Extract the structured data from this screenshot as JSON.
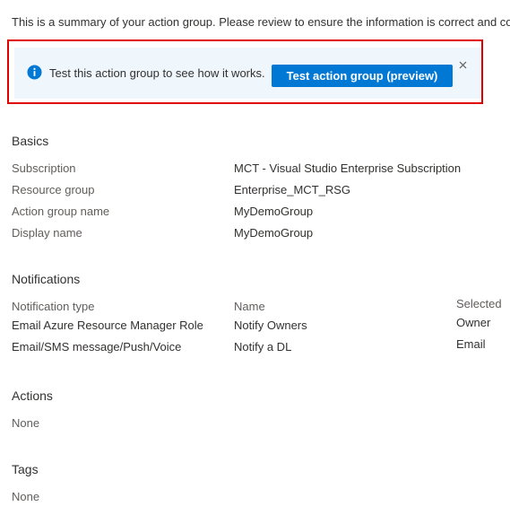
{
  "summary_text": "This is a summary of your action group. Please review to ensure the information is correct and co",
  "infobar": {
    "message": "Test this action group to see how it works.",
    "button_label": "Test action group (preview)",
    "icon": "info-icon",
    "close_icon": "close-icon"
  },
  "colors": {
    "accent": "#0078d4",
    "info_background": "#eff6fc",
    "highlight_border": "#e00000"
  },
  "basics": {
    "title": "Basics",
    "rows": [
      {
        "label": "Subscription",
        "value": "MCT - Visual Studio Enterprise Subscription"
      },
      {
        "label": "Resource group",
        "value": "Enterprise_MCT_RSG"
      },
      {
        "label": "Action group name",
        "value": "MyDemoGroup"
      },
      {
        "label": "Display name",
        "value": "MyDemoGroup"
      }
    ]
  },
  "notifications": {
    "title": "Notifications",
    "headers": {
      "type": "Notification type",
      "name": "Name",
      "selected": "Selected"
    },
    "rows": [
      {
        "type": "Email Azure Resource Manager Role",
        "name": "Notify Owners",
        "selected": "Owner"
      },
      {
        "type": "Email/SMS message/Push/Voice",
        "name": "Notify a DL",
        "selected": "Email"
      }
    ]
  },
  "actions": {
    "title": "Actions",
    "value": "None"
  },
  "tags": {
    "title": "Tags",
    "value": "None"
  }
}
